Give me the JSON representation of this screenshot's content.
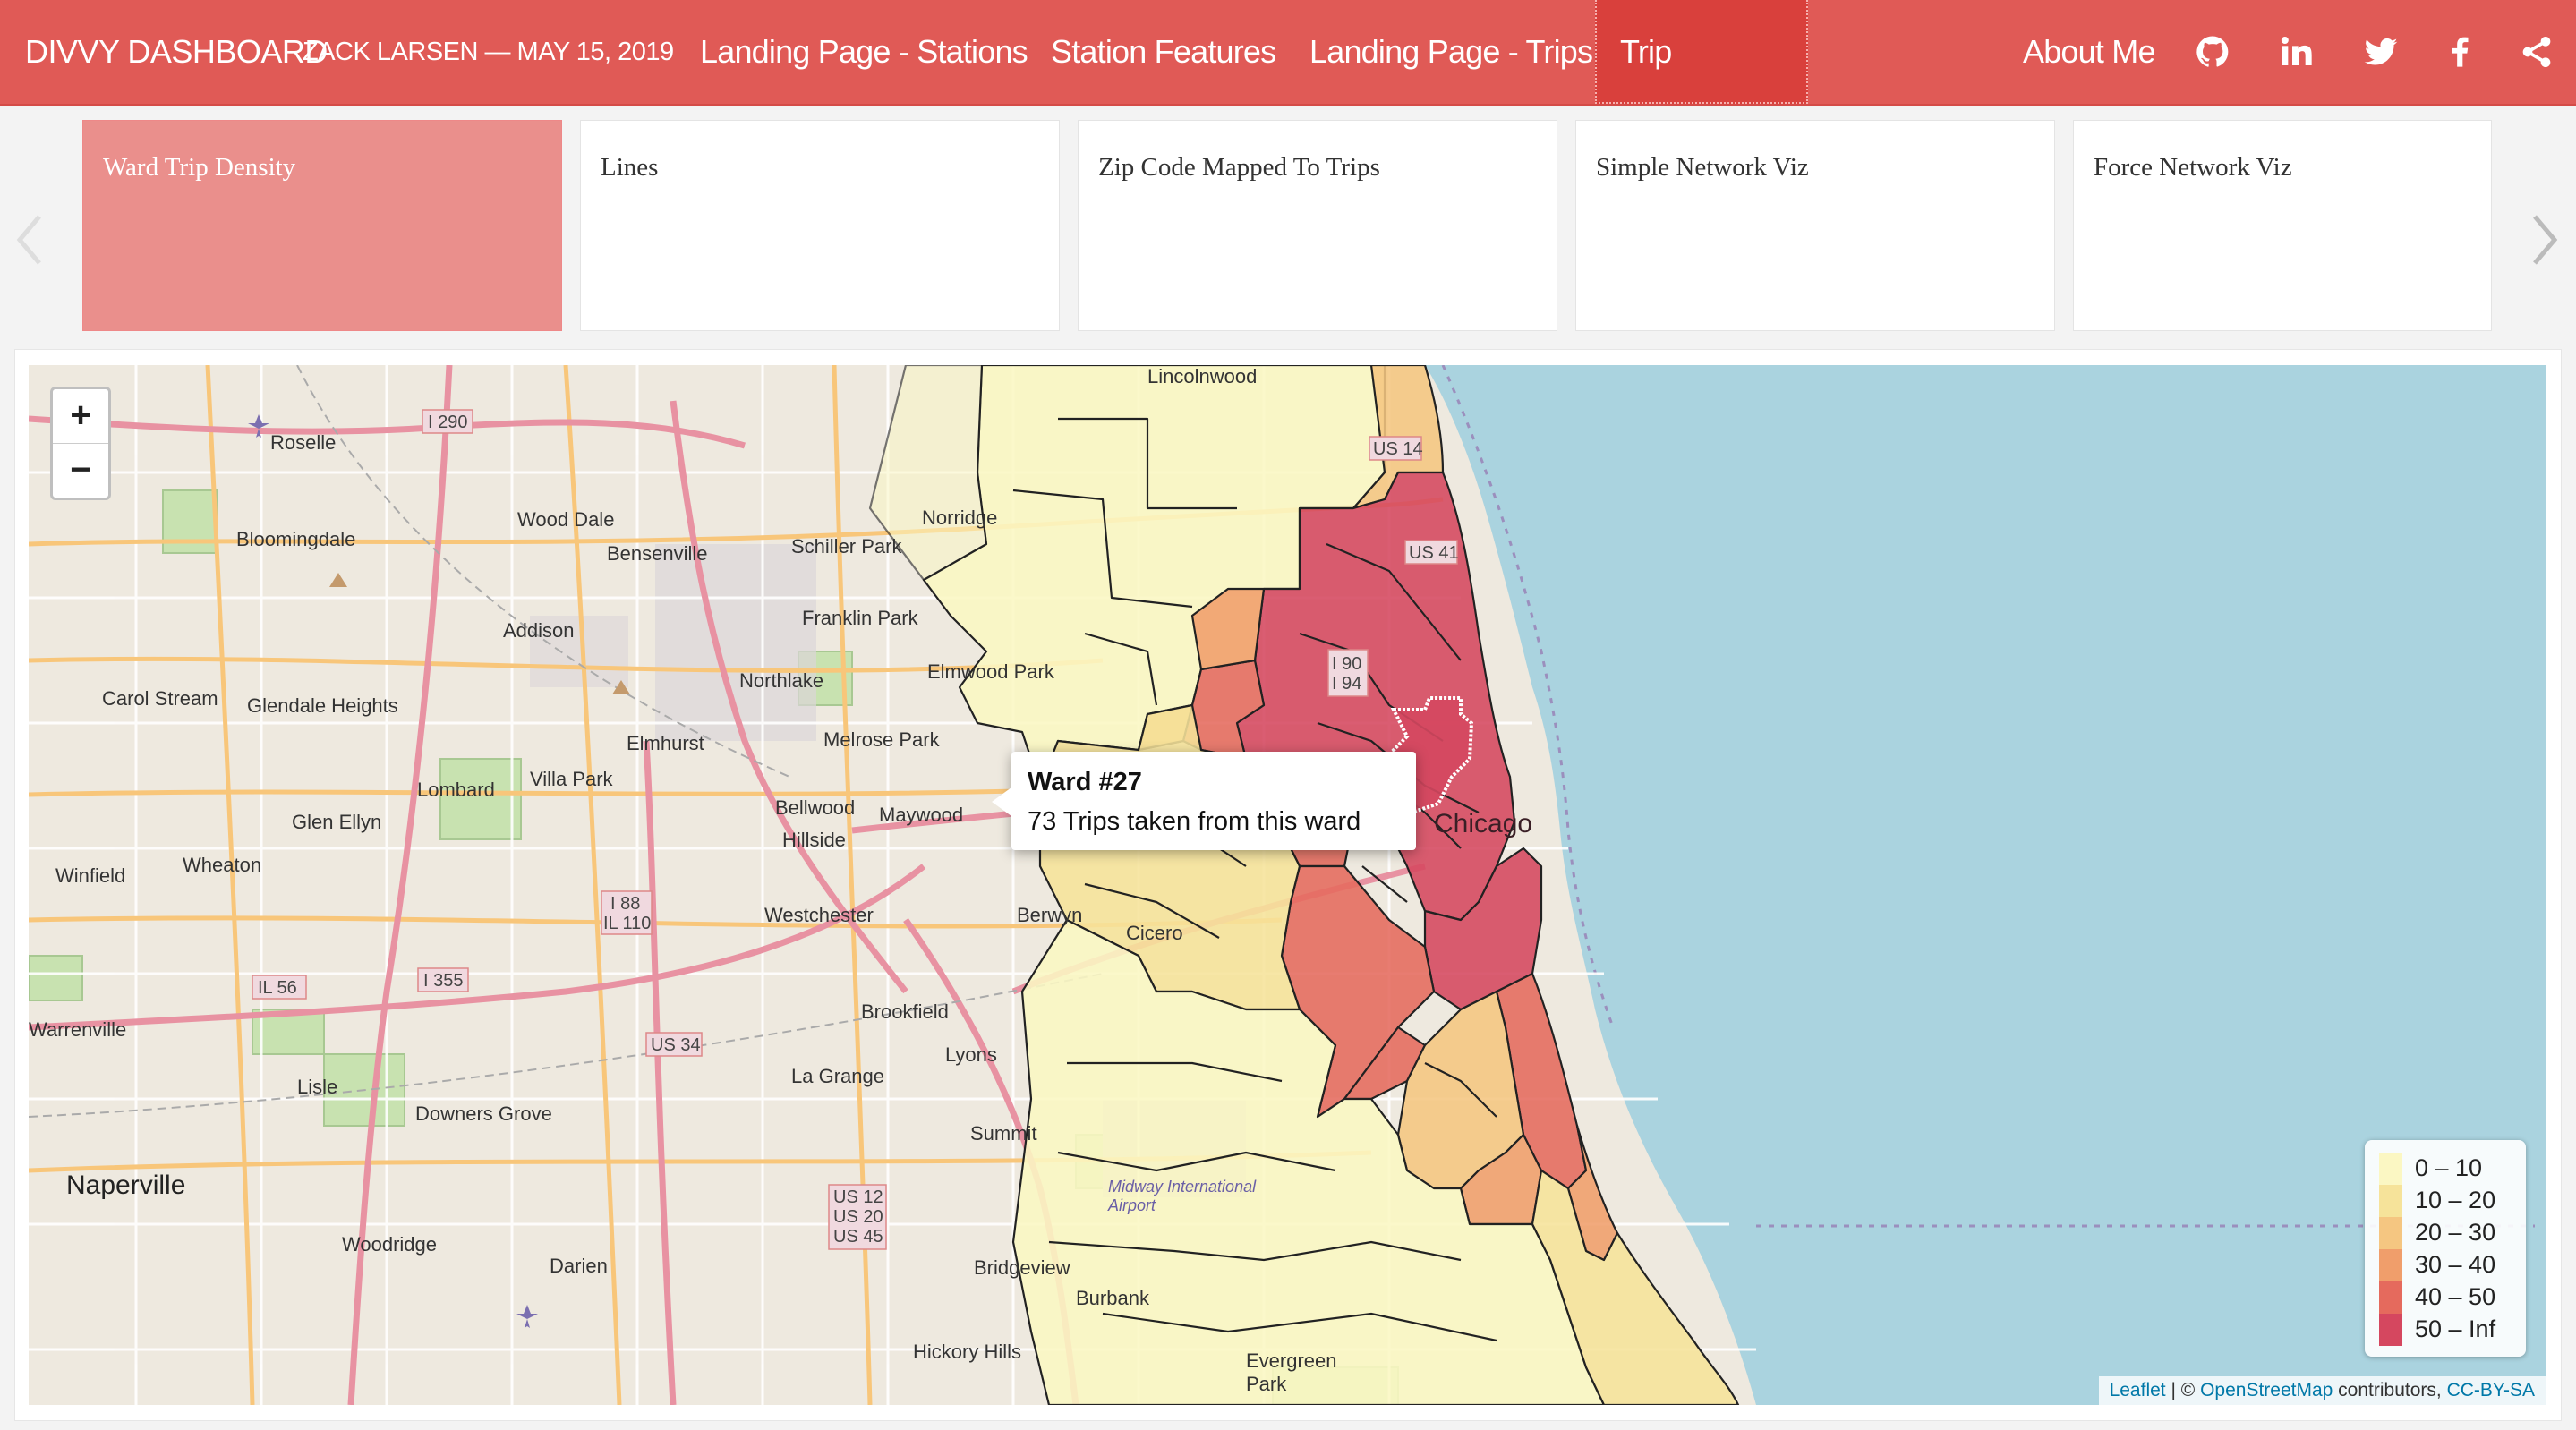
{
  "navbar": {
    "brand": "DIVVY DASHBOARD",
    "subtitle": "ZACK LARSEN — MAY 15, 2019",
    "links": [
      {
        "label": "Landing Page - Stations",
        "active": false
      },
      {
        "label": "Station Features",
        "active": false
      },
      {
        "label": "Landing Page - Trips",
        "active": false
      },
      {
        "label": "Trip Features",
        "active": true
      }
    ],
    "about": "About Me",
    "icons": [
      "github-icon",
      "linkedin-icon",
      "twitter-icon",
      "facebook-icon",
      "share-icon"
    ]
  },
  "carousel": {
    "cards": [
      {
        "label": "Ward Trip Density",
        "active": true
      },
      {
        "label": "Lines",
        "active": false
      },
      {
        "label": "Zip Code Mapped To Trips",
        "active": false
      },
      {
        "label": "Simple Network Viz",
        "active": false
      },
      {
        "label": "Force Network Viz",
        "active": false
      }
    ]
  },
  "map": {
    "zoom_in": "+",
    "zoom_out": "−",
    "popup": {
      "title": "Ward #27",
      "text": "73 Trips taken from this ward"
    },
    "legend": [
      {
        "label": "0 – 10",
        "color": "#fbf7c3"
      },
      {
        "label": "10 – 20",
        "color": "#f6e39a"
      },
      {
        "label": "20 – 30",
        "color": "#f5c681"
      },
      {
        "label": "30 – 40",
        "color": "#f09e6b"
      },
      {
        "label": "40 – 50",
        "color": "#e56a5d"
      },
      {
        "label": "50 – Inf",
        "color": "#d5475f"
      }
    ],
    "attribution": {
      "leaflet": "Leaflet",
      "sep": " | © ",
      "osm": "OpenStreetMap",
      "contrib": " contributors, ",
      "license": "CC-BY-SA"
    },
    "places": [
      "Roselle",
      "Bloomingdale",
      "Wood Dale",
      "Bensenville",
      "Norridge",
      "Schiller Park",
      "Franklin Park",
      "Addison",
      "Northlake",
      "Elmwood Park",
      "Carol Stream",
      "Glendale Heights",
      "Elmhurst",
      "Melrose Park",
      "Villa Park",
      "Lombard",
      "Glen Ellyn",
      "Bellwood",
      "Maywood",
      "Hillside",
      "Wheaton",
      "Winfield",
      "Westchester",
      "Berwyn",
      "Cicero",
      "Brookfield",
      "Lyons",
      "La Grange",
      "Lisle",
      "Downers Grove",
      "Naperville",
      "Woodridge",
      "Darien",
      "Bridgeview",
      "Burbank",
      "Hickory Hills",
      "Evergreen Park",
      "Chicago",
      "Lincolnwood",
      "Midway International Airport",
      "Summit",
      "Warrenville"
    ],
    "colors": {
      "water": "#aad3df",
      "land": "#eee9df",
      "nav": "#e05a56"
    }
  }
}
